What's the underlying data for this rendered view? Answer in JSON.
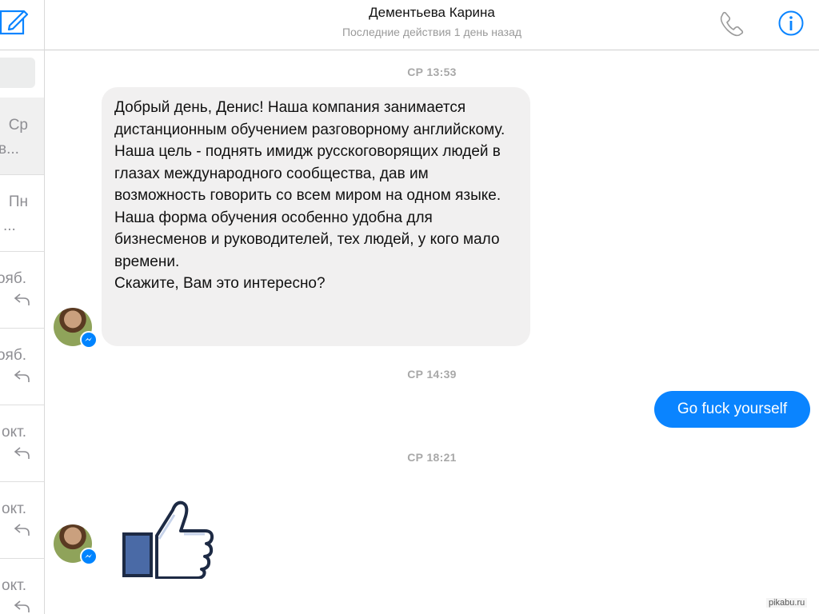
{
  "header": {
    "contact_name": "Дементьева Карина",
    "status": "Последние действия 1 день назад"
  },
  "sidebar": {
    "conversations": [
      {
        "date": "Ср",
        "preview": "в..."
      },
      {
        "date": "Пн",
        "preview": "..."
      },
      {
        "date": "ояб."
      },
      {
        "date": "ояб."
      },
      {
        "date": "окт."
      },
      {
        "date": "окт."
      },
      {
        "date": "окт."
      }
    ]
  },
  "messages": {
    "timestamp_1": "СР 13:53",
    "incoming_text": [
      "Добрый день, Денис! Наша компания занимается дистанционным обучением разговорному английскому. Наша цель - поднять имидж русскоговорящих людей в глазах международного сообщества, дав им возможность говорить со всем миром на одном языке.",
      "Наша форма обучения особенно удобна для бизнесменов и руководителей, тех людей, у кого мало времени.",
      "Скажите, Вам это интересно?"
    ],
    "timestamp_2": "СР 14:39",
    "outgoing_text": "Go fuck yourself",
    "timestamp_3": "СР 18:21",
    "sticker": "thumbs-up-icon"
  },
  "watermark": "pikabu.ru",
  "colors": {
    "accent": "#0a84ff",
    "incoming_bubble": "#f1f0f0",
    "muted_text": "#9a9a9a"
  }
}
